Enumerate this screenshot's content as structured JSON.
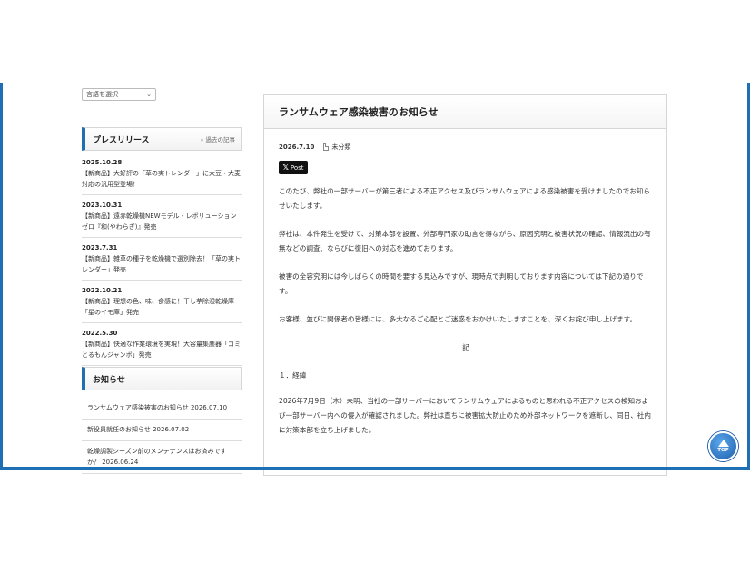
{
  "language_select": {
    "label": "言語を選択"
  },
  "press_release": {
    "title": "プレスリリース",
    "more_link": "過去の記事",
    "items": [
      {
        "date": "2025.10.28",
        "text": "【新商品】大好評の「草の実トレンダー」に大豆・大麦対応の汎用型登場！"
      },
      {
        "date": "2023.10.31",
        "text": "【新商品】遠赤乾燥機NEWモデル・レボリューションゼロ『和(やわらぎ)』発売"
      },
      {
        "date": "2023.7.31",
        "text": "【新商品】雑草の種子を乾燥機で選別除去！「草の実トレンダー」発売"
      },
      {
        "date": "2022.10.21",
        "text": "【新商品】理想の色、味、食感に！干し芋除湿乾燥庫「星のイモ庫」発売"
      },
      {
        "date": "2022.5.30",
        "text": "【新商品】快適な作業環境を実現！大容量集塵器「ゴミとるもんジャンボ」発売"
      }
    ]
  },
  "news": {
    "title": "お知らせ",
    "items": [
      {
        "text": "ランサムウェア感染被害のお知らせ 2026.07.10"
      },
      {
        "text": "新役員就任のお知らせ 2026.07.02"
      },
      {
        "text": "乾燥調製シーズン前のメンテナンスはお済みですか？ 2026.06.24"
      }
    ]
  },
  "article": {
    "title": "ランサムウェア感染被害のお知らせ",
    "date": "2026.7.10",
    "category": "未分類",
    "post_button": "Post",
    "paragraphs": [
      "このたび、弊社の一部サーバーが第三者による不正アクセス及びランサムウェアによる感染被害を受けましたのでお知らせいたします。",
      "弊社は、本件発生を受けて、対策本部を設置、外部専門家の助言を得ながら、原因究明と被害状況の確認、情報流出の有無などの調査、ならびに復旧への対応を進めております。",
      "被害の全容究明には今しばらくの時間を要する見込みですが、現時点で判明しております内容については下記の通りです。",
      "お客様、並びに関係者の皆様には、多大なるご心配とご迷惑をおかけいたしますことを、深くお詫び申し上げます。"
    ],
    "note_mark": "記",
    "section_heading": "１．経緯",
    "section_text": "2026年7月9日（木）未明、当社の一部サーバーにおいてランサムウェアによるものと思われる不正アクセスの検知および一部サーバー内への侵入が確認されました。弊社は直ちに被害拡大防止のため外部ネットワークを遮断し、同日、社内に対策本部を立ち上げました。"
  },
  "top_button": {
    "label": "TOP"
  }
}
